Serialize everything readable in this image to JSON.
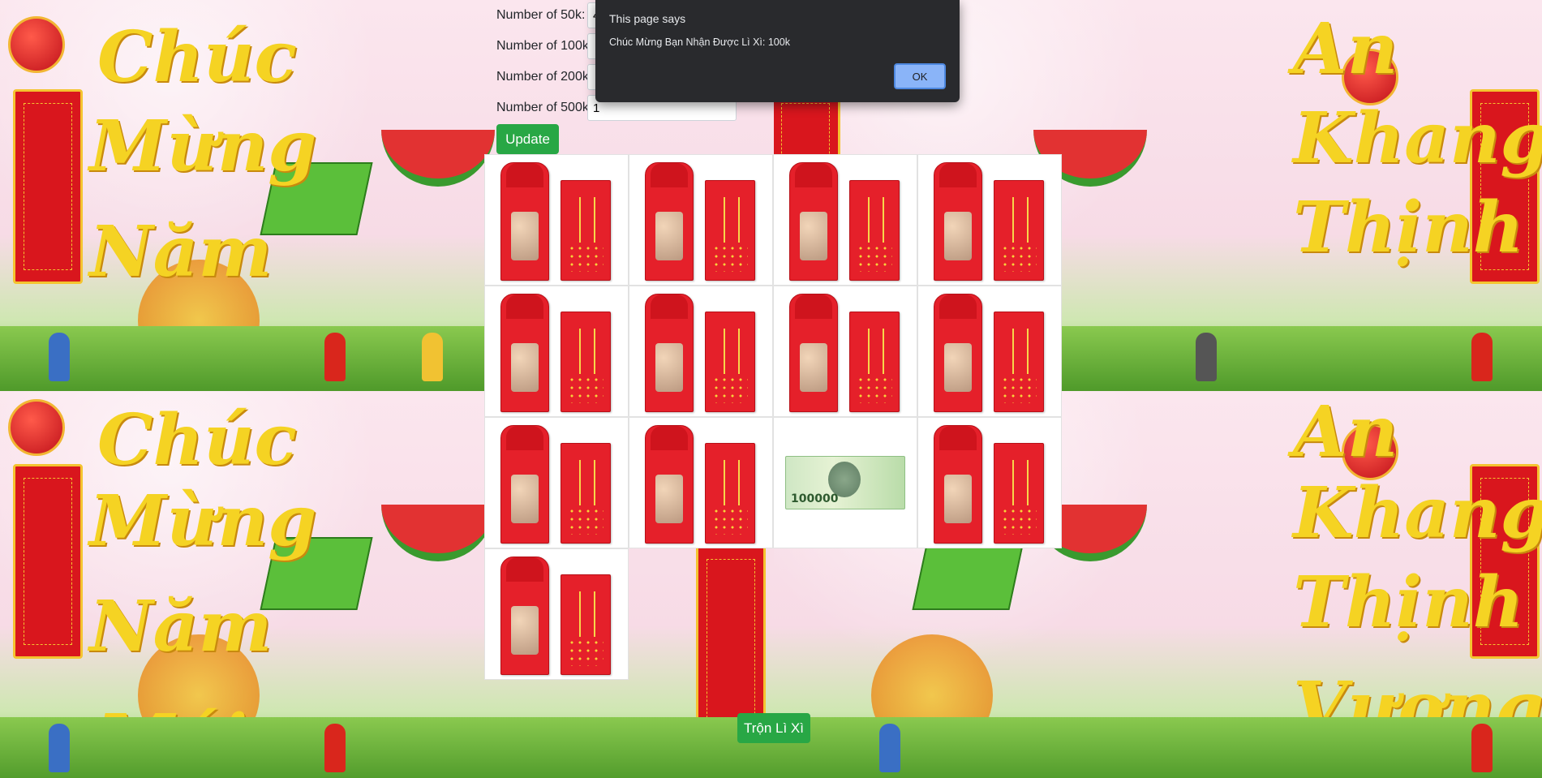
{
  "form": {
    "fields": [
      {
        "label": "Number of 50k:",
        "value": "4"
      },
      {
        "label": "Number of 100k:",
        "value": ""
      },
      {
        "label": "Number of 200k:",
        "value": ""
      },
      {
        "label": "Number of 500k:",
        "value": "1"
      }
    ],
    "update_label": "Update"
  },
  "grid": {
    "cells": [
      {
        "kind": "envelope"
      },
      {
        "kind": "envelope"
      },
      {
        "kind": "envelope"
      },
      {
        "kind": "envelope"
      },
      {
        "kind": "envelope"
      },
      {
        "kind": "envelope"
      },
      {
        "kind": "envelope"
      },
      {
        "kind": "envelope"
      },
      {
        "kind": "envelope"
      },
      {
        "kind": "envelope"
      },
      {
        "kind": "banknote",
        "value": "100000"
      },
      {
        "kind": "envelope"
      },
      {
        "kind": "envelope"
      }
    ]
  },
  "shuffle_label": "Trộn Lì Xì",
  "dialog": {
    "title": "This page says",
    "message": "Chúc Mừng Bạn Nhận Được Lì Xì: 100k",
    "ok_label": "OK"
  },
  "background": {
    "words_left": [
      "Chúc",
      "Mừng",
      "Năm",
      "Mới"
    ],
    "words_right": [
      "An",
      "Khang",
      "Thịnh",
      "Vượng"
    ]
  },
  "colors": {
    "accent_green": "#28a745",
    "envelope_red": "#e5202a",
    "dialog_bg": "#292a2d",
    "ok_blue": "#8ab4f8"
  }
}
